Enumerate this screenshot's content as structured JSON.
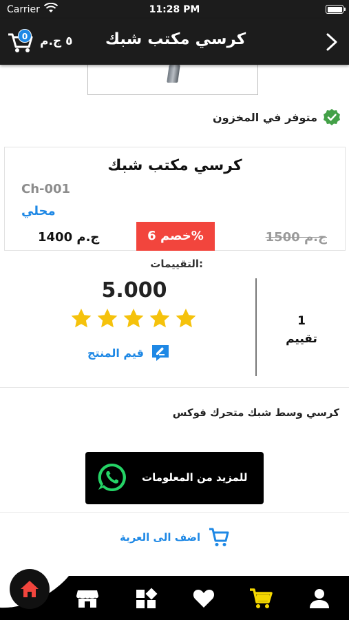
{
  "status_bar": {
    "carrier": "Carrier",
    "time": "11:28 PM"
  },
  "header": {
    "title": "كرسي مكتب شبك",
    "cart_badge": "0",
    "cart_total": "٥ ج.م",
    "accent_color": "#1e88e5"
  },
  "stock": {
    "label": "متوفر في المخزون",
    "icon": "check-badge-icon",
    "color": "#43a047"
  },
  "product": {
    "name": "كرسي مكتب شبك",
    "sku": "Ch-001",
    "origin": "محلي",
    "price": "1400 ج.م",
    "discount": "خصم 6%",
    "old_price": "1500 ج.م",
    "discount_color": "#f2453d"
  },
  "ratings": {
    "label": "التقييمات:",
    "score": "5.000",
    "stars": 5,
    "star_color": "#f5c20c",
    "rate_label": "قيم المنتج",
    "count": "1",
    "count_label": "تقييم"
  },
  "description": "كرسي وسط شبك متحرك فوكس",
  "whatsapp": {
    "label": "للمزيد من المعلومات",
    "icon": "whatsapp-icon",
    "color": "#25d366"
  },
  "add_to_cart": {
    "label": "اضف الى العربة",
    "icon": "cart-icon"
  },
  "tab_bar": {
    "items": [
      {
        "icon": "home-icon",
        "active": true
      },
      {
        "icon": "store-icon"
      },
      {
        "icon": "categories-icon"
      },
      {
        "icon": "heart-icon"
      },
      {
        "icon": "cart-icon",
        "color": "#f5d800"
      },
      {
        "icon": "profile-icon"
      }
    ]
  }
}
